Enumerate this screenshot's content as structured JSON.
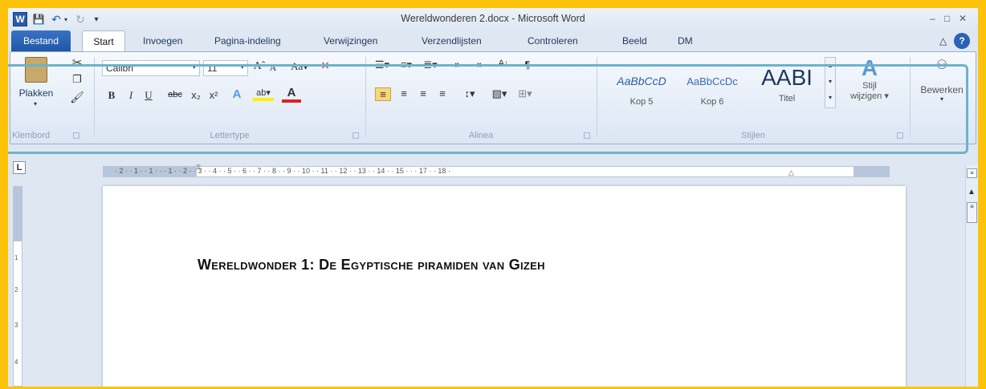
{
  "window": {
    "title": "Wereldwonderen 2.docx - Microsoft Word",
    "app_icon": "W"
  },
  "tabs": [
    "Bestand",
    "Start",
    "Invoegen",
    "Pagina-indeling",
    "Verwijzingen",
    "Verzendlijsten",
    "Controleren",
    "Beeld",
    "DM"
  ],
  "ribbon": {
    "clipboard": {
      "paste_label": "Plakken",
      "group_label": "Klembord"
    },
    "font": {
      "font_name": "Calibri",
      "font_size": "11",
      "group_label": "Lettertype"
    },
    "paragraph": {
      "group_label": "Alinea"
    },
    "styles": {
      "items": [
        {
          "preview": "AaBbCcD",
          "name": "Kop 5"
        },
        {
          "preview": "AaBbCcDc",
          "name": "Kop 6"
        },
        {
          "preview": "AABI",
          "name": "Titel"
        }
      ],
      "change_label_1": "Stijl",
      "change_label_2": "wijzigen",
      "group_label": "Stijlen"
    },
    "editing": {
      "label": "Bewerken"
    }
  },
  "ruler": {
    "marks": "· 2 · · 1 · · 1 · · · 1 · · 2 · · 3 · · 4 · · 5 · · 6 · · 7 · · 8 · · 9 · · 10 · · 11 · · 12 · · 13 · · 14 · · 15 · · · 17 · · 18 ·",
    "vertical_marks": [
      "1",
      "2",
      "3",
      "4"
    ]
  },
  "document": {
    "heading": "Wereldwonder 1: De Egyptische piramiden van Gizeh"
  },
  "colors": {
    "frame": "#fcc30a",
    "ribbon_highlight": "#6cb2cc",
    "file_tab": "#2a62b5"
  }
}
